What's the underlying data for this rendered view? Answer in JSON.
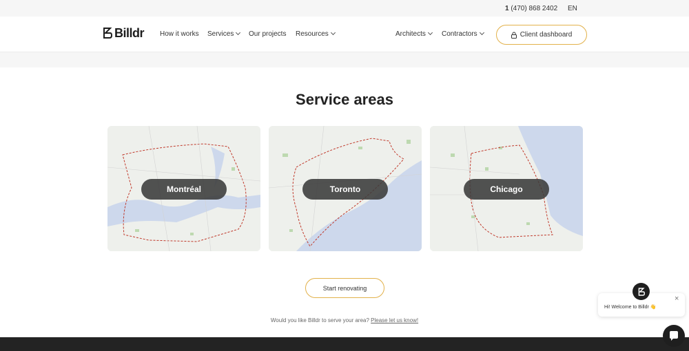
{
  "topbar": {
    "phone_prefix": "1",
    "phone_rest": "(470) 868 2402",
    "language": "EN"
  },
  "brand": {
    "name": "Billdr"
  },
  "nav": {
    "how_it_works": "How it works",
    "services": "Services",
    "our_projects": "Our projects",
    "resources": "Resources",
    "architects": "Architects",
    "contractors": "Contractors",
    "client_dashboard": "Client dashboard"
  },
  "section": {
    "title": "Service areas"
  },
  "areas": [
    {
      "city": "Montréal"
    },
    {
      "city": "Toronto"
    },
    {
      "city": "Chicago"
    }
  ],
  "cta": {
    "start_renovating": "Start renovating"
  },
  "serve": {
    "text": "Would you like Billdr to serve your area?",
    "link": "Please let us know!"
  },
  "chat": {
    "greeting": "Hi! Welcome to Billdr 👋",
    "close": "×"
  },
  "colors": {
    "accent": "#e2b14a",
    "dark": "#232323",
    "water": "#cdd8ec",
    "route": "#c0392b"
  }
}
